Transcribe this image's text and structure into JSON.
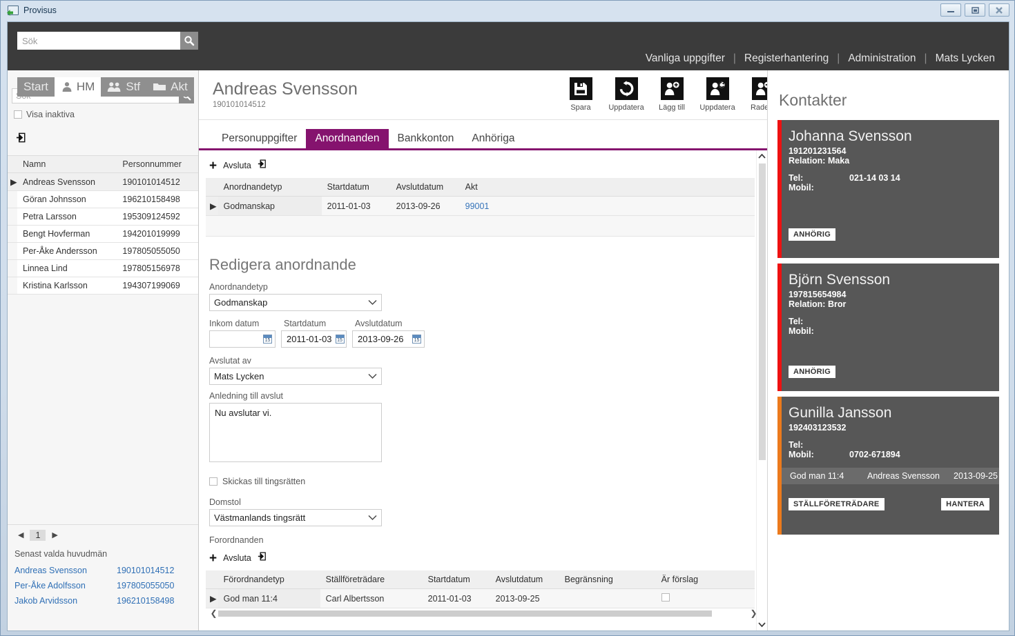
{
  "window": {
    "title": "Provisus",
    "controls": {
      "minimize": "minimize",
      "maximize": "maximize",
      "close": "close"
    }
  },
  "topbar": {
    "search_placeholder": "Sök",
    "search_value": "",
    "nav": [
      {
        "label": "Vanliga uppgifter"
      },
      {
        "label": "Registerhantering"
      },
      {
        "label": "Administration"
      }
    ],
    "separator": "|",
    "user": "Mats Lycken"
  },
  "tabstrip": [
    {
      "label": "Start",
      "icon": "",
      "active": false
    },
    {
      "label": "HM",
      "icon": "person-icon",
      "active": true
    },
    {
      "label": "Stf",
      "icon": "people-icon",
      "active": false
    },
    {
      "label": "Akt",
      "icon": "folder-icon",
      "active": false
    }
  ],
  "left_panel": {
    "search_placeholder": "Sök",
    "search_value": "",
    "show_inactive_label": "Visa inaktiva",
    "show_inactive_checked": false,
    "export_icon": "export-icon",
    "columns": [
      "Namn",
      "Personnummer"
    ],
    "rows": [
      {
        "namn": "Andreas Svensson",
        "personnummer": "190101014512",
        "selected": true
      },
      {
        "namn": "Göran Johnsson",
        "personnummer": "196210158498",
        "selected": false
      },
      {
        "namn": "Petra Larsson",
        "personnummer": "195309124592",
        "selected": false
      },
      {
        "namn": "Bengt Hovferman",
        "personnummer": "194201019999",
        "selected": false
      },
      {
        "namn": "Per-Åke Andersson",
        "personnummer": "197805055050",
        "selected": false
      },
      {
        "namn": "Linnea Lind",
        "personnummer": "197805156978",
        "selected": false
      },
      {
        "namn": "Kristina Karlsson",
        "personnummer": "194307199069",
        "selected": false
      }
    ],
    "pager": {
      "prev": "◀",
      "page": "1",
      "next": "▶"
    },
    "recent_title": "Senast valda huvudmän",
    "recent": [
      {
        "namn": "Andreas Svensson",
        "personnummer": "190101014512"
      },
      {
        "namn": "Per-Åke Adolfsson",
        "personnummer": "197805055050"
      },
      {
        "namn": "Jakob Arvidsson",
        "personnummer": "196210158498"
      }
    ]
  },
  "record": {
    "name": "Andreas Svensson",
    "personnummer": "190101014512",
    "toolbar": [
      {
        "label": "Spara",
        "icon": "save-icon"
      },
      {
        "label": "Uppdatera",
        "icon": "refresh-icon"
      },
      {
        "label": "Lägg till",
        "icon": "add-person-icon"
      },
      {
        "label": "Uppdatera",
        "icon": "edit-person-icon"
      },
      {
        "label": "Radera",
        "icon": "delete-person-icon"
      }
    ],
    "tabs": [
      {
        "label": "Personuppgifter",
        "active": false
      },
      {
        "label": "Anordnanden",
        "active": true
      },
      {
        "label": "Bankkonton",
        "active": false
      },
      {
        "label": "Anhöriga",
        "active": false
      }
    ]
  },
  "anordnanden": {
    "actions": {
      "add": "+",
      "close_label": "Avsluta",
      "export_icon": "export-icon"
    },
    "columns": [
      "Anordnandetyp",
      "Startdatum",
      "Avslutdatum",
      "Akt"
    ],
    "rows": [
      {
        "anordnandetyp": "Godmanskap",
        "startdatum": "2011-01-03",
        "avslutdatum": "2013-09-26",
        "akt": "99001",
        "selected": true
      }
    ]
  },
  "edit_form": {
    "title": "Redigera anordnande",
    "anordnandetyp_label": "Anordnandetyp",
    "anordnandetyp_value": "Godmanskap",
    "inkom_datum_label": "Inkom datum",
    "inkom_datum_value": "",
    "startdatum_label": "Startdatum",
    "startdatum_value": "2011-01-03",
    "avslutdatum_label": "Avslutdatum",
    "avslutdatum_value": "2013-09-26",
    "avslutat_av_label": "Avslutat av",
    "avslutat_av_value": "Mats Lycken",
    "anledning_label": "Anledning till avslut",
    "anledning_value": "Nu avslutar vi.",
    "skickas_label": "Skickas till tingsrätten",
    "skickas_checked": false,
    "domstol_label": "Domstol",
    "domstol_value": "Västmanlands tingsrätt"
  },
  "forordnanden": {
    "section_label": "Forordnanden",
    "actions": {
      "add": "+",
      "close_label": "Avsluta",
      "export_icon": "export-icon"
    },
    "columns": [
      "Förordnandetyp",
      "Ställföreträdare",
      "Startdatum",
      "Avslutdatum",
      "Begränsning",
      "Är förslag"
    ],
    "rows": [
      {
        "forordnandetyp": "God man 11:4",
        "stallforetradare": "Carl Albertsson",
        "startdatum": "2011-01-03",
        "avslutdatum": "2013-09-25",
        "begransning": "",
        "ar_forslag": false,
        "selected": true
      }
    ]
  },
  "kontakter": {
    "title": "Kontakter",
    "cards": [
      {
        "name": "Johanna Svensson",
        "personnummer": "191201231564",
        "relation": "Relation: Maka",
        "tel_label": "Tel:",
        "tel_value": "021-14 03 14",
        "mobil_label": "Mobil:",
        "mobil_value": "",
        "stripe_color": "#ee1111",
        "badges": [
          {
            "label": "ANHÖRIG"
          }
        ],
        "assignment": null
      },
      {
        "name": "Björn Svensson",
        "personnummer": "197815654984",
        "relation": "Relation: Bror",
        "tel_label": "Tel:",
        "tel_value": "",
        "mobil_label": "Mobil:",
        "mobil_value": "",
        "stripe_color": "#ee1111",
        "badges": [
          {
            "label": "ANHÖRIG"
          }
        ],
        "assignment": null
      },
      {
        "name": "Gunilla Jansson",
        "personnummer": "192403123532",
        "relation": "",
        "tel_label": "Tel:",
        "tel_value": "",
        "mobil_label": "Mobil:",
        "mobil_value": "0702-671894",
        "stripe_color": "#ec7a1c",
        "badges": [
          {
            "label": "STÄLLFÖRETRÄDARE"
          },
          {
            "label": "HANTERA"
          }
        ],
        "assignment": {
          "type": "God man 11:4",
          "person": "Andreas Svensson",
          "date": "2013-09-25"
        }
      }
    ]
  },
  "colors": {
    "accent_purple": "#85136e",
    "topbar_dark": "#3b3b3b",
    "card_gray": "#575757",
    "link_blue": "#3573b9"
  }
}
